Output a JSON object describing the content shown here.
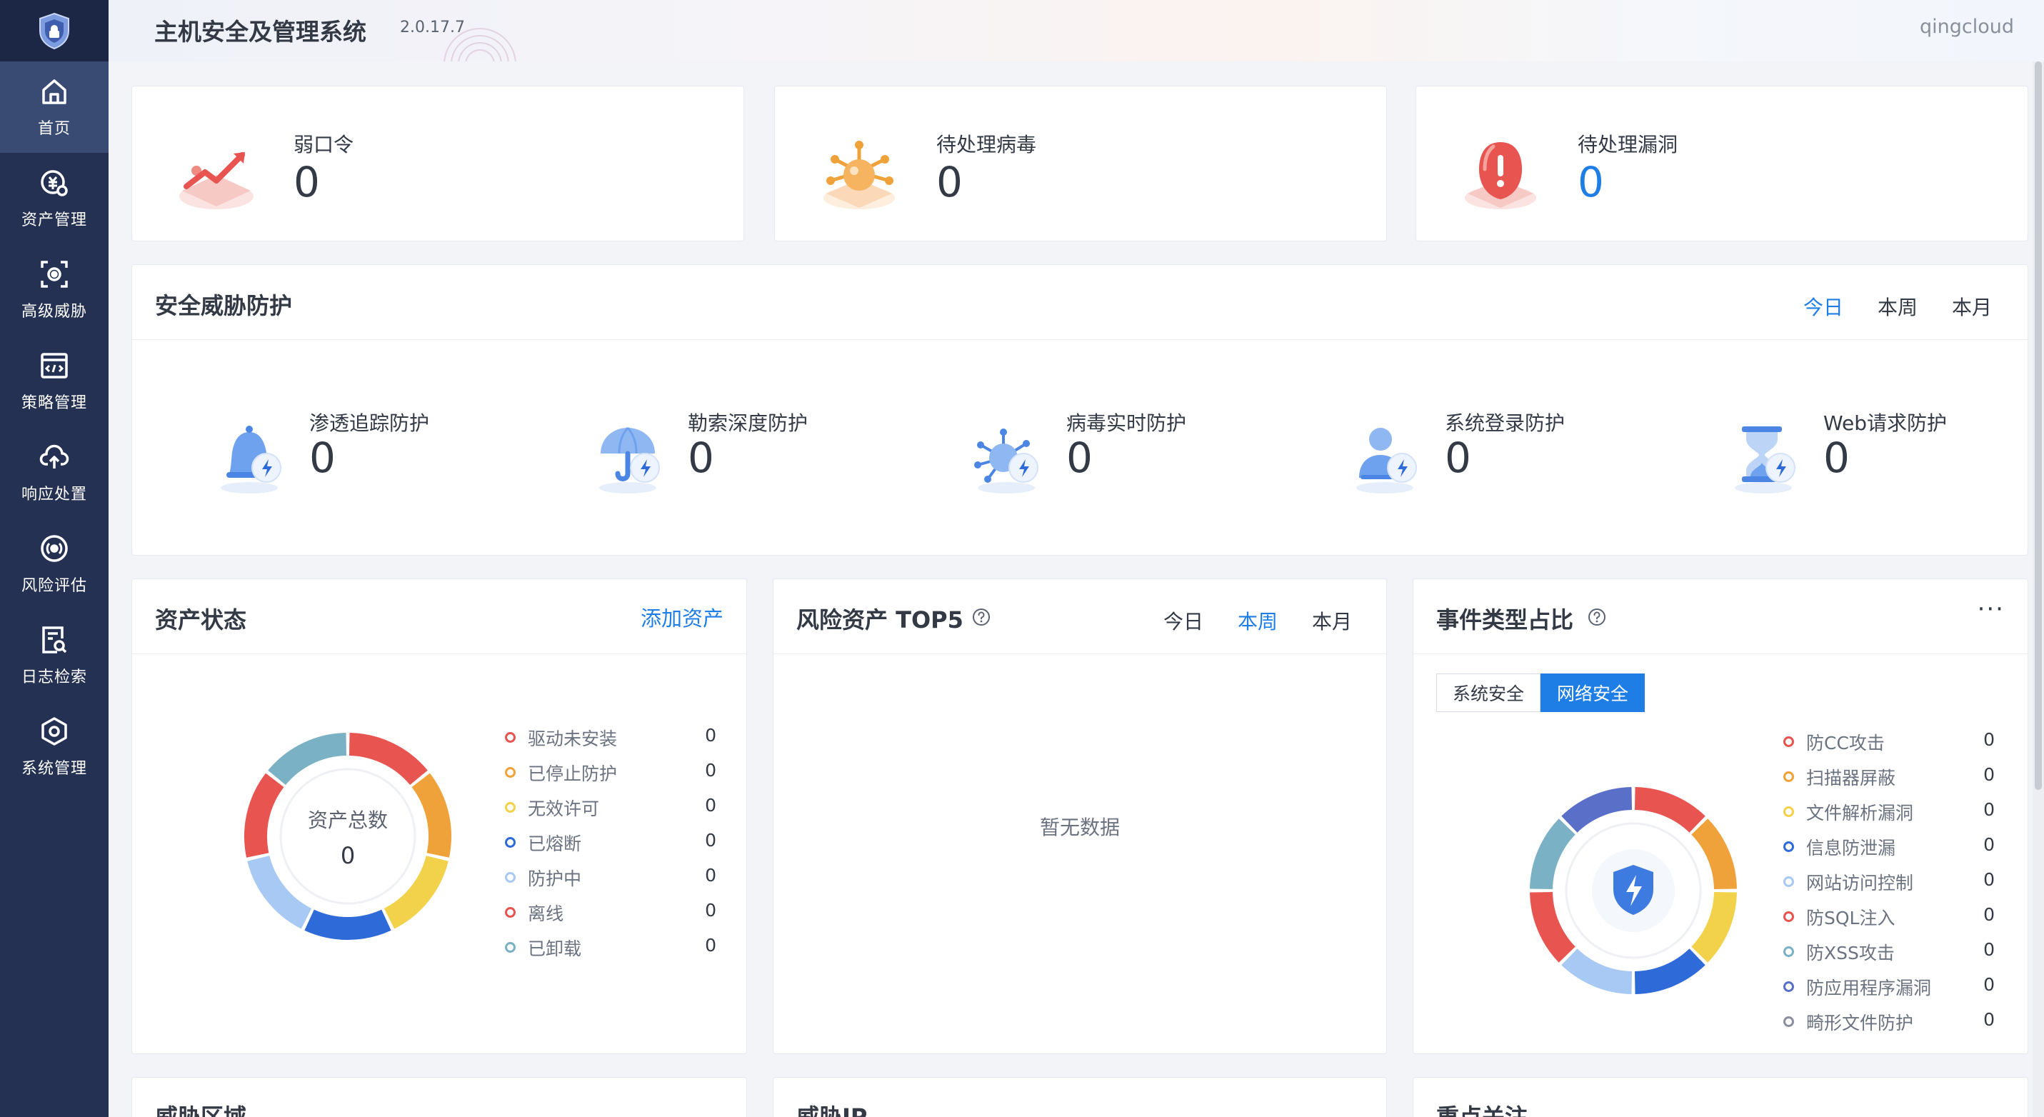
{
  "header": {
    "title": "主机安全及管理系统",
    "version": "2.0.17.7",
    "tenant": "qingcloud"
  },
  "sidebar": {
    "items": [
      {
        "label": "首页",
        "icon": "home-icon",
        "active": true
      },
      {
        "label": "资产管理",
        "icon": "asset-icon",
        "active": false
      },
      {
        "label": "高级威胁",
        "icon": "threat-icon",
        "active": false
      },
      {
        "label": "策略管理",
        "icon": "policy-icon",
        "active": false
      },
      {
        "label": "响应处置",
        "icon": "cloud-upload-icon",
        "active": false
      },
      {
        "label": "风险评估",
        "icon": "radar-icon",
        "active": false
      },
      {
        "label": "日志检索",
        "icon": "log-search-icon",
        "active": false
      },
      {
        "label": "系统管理",
        "icon": "settings-icon",
        "active": false
      }
    ]
  },
  "stats": [
    {
      "label": "弱口令",
      "value": "0",
      "icon": "weak-password-icon",
      "color": "#e8544f"
    },
    {
      "label": "待处理病毒",
      "value": "0",
      "icon": "virus-icon",
      "color": "#f0a23a"
    },
    {
      "label": "待处理漏洞",
      "value": "0",
      "icon": "alert-shield-icon",
      "color": "#e8544f"
    }
  ],
  "threat_protection": {
    "title": "安全威胁防护",
    "tabs": [
      "今日",
      "本周",
      "本月"
    ],
    "active_tab": "今日",
    "items": [
      {
        "label": "渗透追踪防护",
        "value": "0",
        "icon": "bell-icon"
      },
      {
        "label": "勒索深度防护",
        "value": "0",
        "icon": "umbrella-icon"
      },
      {
        "label": "病毒实时防护",
        "value": "0",
        "icon": "virus-shield-icon"
      },
      {
        "label": "系统登录防护",
        "value": "0",
        "icon": "user-shield-icon"
      },
      {
        "label": "Web请求防护",
        "value": "0",
        "icon": "hourglass-icon"
      }
    ]
  },
  "asset_status": {
    "title": "资产状态",
    "add_label": "添加资产",
    "center_label": "资产总数",
    "total": "0",
    "legend": [
      {
        "name": "驱动未安装",
        "value": "0",
        "color": "#e8544f"
      },
      {
        "name": "已停止防护",
        "value": "0",
        "color": "#f0a23a"
      },
      {
        "name": "无效许可",
        "value": "0",
        "color": "#f2d14b"
      },
      {
        "name": "已熔断",
        "value": "0",
        "color": "#2f6bd8"
      },
      {
        "name": "防护中",
        "value": "0",
        "color": "#a9c9f5"
      },
      {
        "name": "离线",
        "value": "0",
        "color": "#e8544f"
      },
      {
        "name": "已卸载",
        "value": "0",
        "color": "#7ab1c4"
      }
    ]
  },
  "risk_assets": {
    "title": "风险资产 TOP5",
    "tabs": [
      "今日",
      "本周",
      "本月"
    ],
    "active_tab": "本周",
    "empty_text": "暂无数据"
  },
  "event_types": {
    "title": "事件类型占比",
    "more_label": "···",
    "segments": [
      "系统安全",
      "网络安全"
    ],
    "active_segment": "网络安全",
    "legend": [
      {
        "name": "防CC攻击",
        "value": "0",
        "color": "#e8544f"
      },
      {
        "name": "扫描器屏蔽",
        "value": "0",
        "color": "#f0a23a"
      },
      {
        "name": "文件解析漏洞",
        "value": "0",
        "color": "#f2d14b"
      },
      {
        "name": "信息防泄漏",
        "value": "0",
        "color": "#2f6bd8"
      },
      {
        "name": "网站访问控制",
        "value": "0",
        "color": "#a9c9f5"
      },
      {
        "name": "防SQL注入",
        "value": "0",
        "color": "#e8544f"
      },
      {
        "name": "防XSS攻击",
        "value": "0",
        "color": "#7ab1c4"
      },
      {
        "name": "防应用程序漏洞",
        "value": "0",
        "color": "#5a6fc8"
      },
      {
        "name": "畸形文件防护",
        "value": "0",
        "color": "#8a8fa0"
      }
    ]
  },
  "bottom_cards": [
    {
      "title": "威胁区域"
    },
    {
      "title": "威胁IP"
    },
    {
      "title": "重点关注"
    }
  ]
}
